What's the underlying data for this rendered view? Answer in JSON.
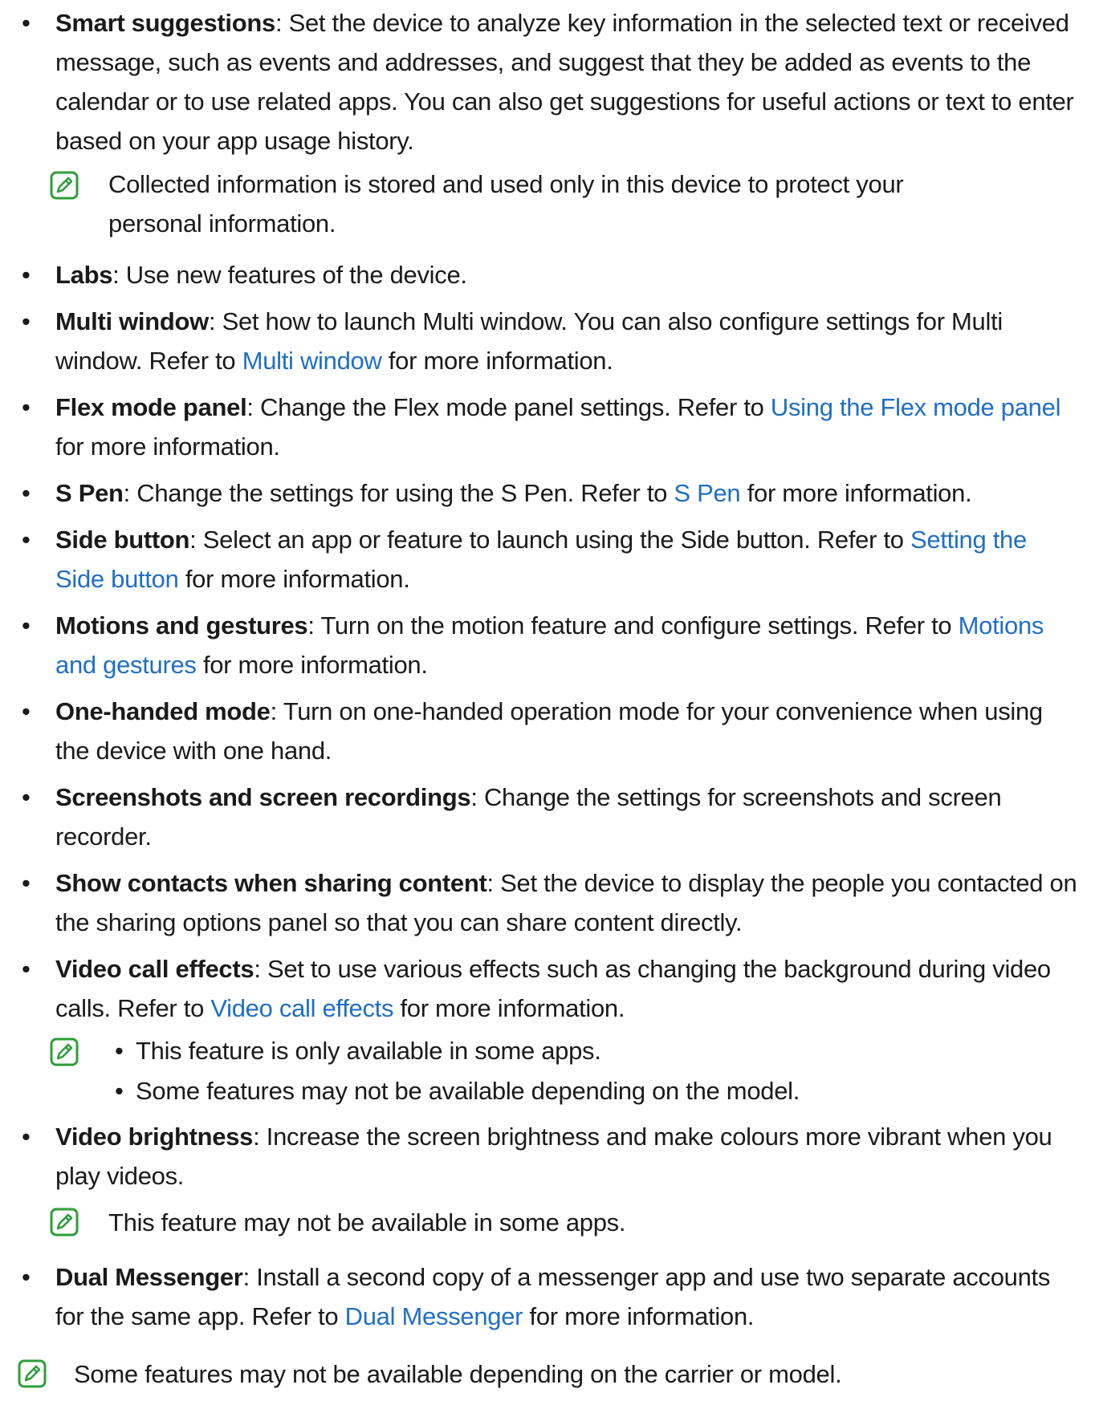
{
  "items": [
    {
      "label": "Smart suggestions",
      "text": ": Set the device to analyze key information in the selected text or received message, such as events and addresses, and suggest that they be added as events to the calendar or to use related apps. You can also get suggestions for useful actions or text to enter based on your app usage history."
    },
    {
      "label": "Labs",
      "text": ": Use new features of the device."
    },
    {
      "label": "Multi window",
      "text": ": Set how to launch Multi window. You can also configure settings for Multi window. Refer to ",
      "link": "Multi window",
      "after": " for more information."
    },
    {
      "label": "Flex mode panel",
      "text": ": Change the Flex mode panel settings. Refer to ",
      "link": "Using the Flex mode panel",
      "after": " for more information."
    },
    {
      "label": "S Pen",
      "text": ": Change the settings for using the S Pen. Refer to ",
      "link": "S Pen",
      "after": " for more information."
    },
    {
      "label": "Side button",
      "text": ": Select an app or feature to launch using the Side button. Refer to ",
      "link": "Setting the Side button",
      "after": " for more information."
    },
    {
      "label": "Motions and gestures",
      "text": ": Turn on the motion feature and configure settings. Refer to ",
      "link": "Motions and gestures",
      "after": " for more information."
    },
    {
      "label": "One-handed mode",
      "text": ": Turn on one-handed operation mode for your convenience when using the device with one hand."
    },
    {
      "label": "Screenshots and screen recordings",
      "text": ": Change the settings for screenshots and screen recorder."
    },
    {
      "label": "Show contacts when sharing content",
      "text": ": Set the device to display the people you contacted on the sharing options panel so that you can share content directly."
    },
    {
      "label": "Video call effects",
      "text": ": Set to use various effects such as changing the background during video calls. Refer to ",
      "link": "Video call effects",
      "after": " for more information."
    },
    {
      "label": "Video brightness",
      "text": ": Increase the screen brightness and make colours more vibrant when you play videos."
    },
    {
      "label": "Dual Messenger",
      "text": ": Install a second copy of a messenger app and use two separate accounts for the same app. Refer to ",
      "link": "Dual Messenger",
      "after": " for more information."
    }
  ],
  "notes": {
    "smart_suggestions": "Collected information is stored and used only in this device to protect your personal information.",
    "video_call_effects": [
      "This feature is only available in some apps.",
      "Some features may not be available depending on the model."
    ],
    "video_brightness": "This feature may not be available in some apps.",
    "footer": "Some features may not be available depending on the carrier or model."
  },
  "bullet_glyph": "•",
  "note_icon": "note-pencil-icon",
  "colors": {
    "link": "#1f6fc5",
    "note_icon": "#2e9e3a",
    "text": "#1a1a1a"
  }
}
